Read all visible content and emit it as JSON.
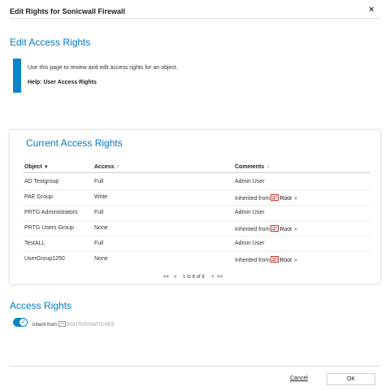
{
  "window": {
    "title": "Edit Rights for Sonicwall Firewall",
    "close_symbol": "×"
  },
  "intro": {
    "heading": "Edit Access Rights",
    "description": "Use this page to review and edit access rights for an object.",
    "help_link": "Help: User Access Rights"
  },
  "table": {
    "title": "Current Access Rights",
    "columns": [
      "Object",
      "Access",
      "Comments"
    ],
    "rows": [
      {
        "object": "AD Testgroup",
        "access": "Full",
        "comment": "Admin User",
        "inherit_target": ""
      },
      {
        "object": "PAE Group",
        "access": "Write",
        "comment": "Inherited from",
        "inherit_target": "Root"
      },
      {
        "object": "PRTG Administrators",
        "access": "Full",
        "comment": "Admin User",
        "inherit_target": ""
      },
      {
        "object": "PRTG Users Group",
        "access": "None",
        "comment": "Inherited from",
        "inherit_target": "Root"
      },
      {
        "object": "TestALL",
        "access": "Full",
        "comment": "Admin User",
        "inherit_target": ""
      },
      {
        "object": "UserGroup1250",
        "access": "None",
        "comment": "Inherited from",
        "inherit_target": "Root"
      }
    ],
    "pagination": {
      "first": "<<",
      "prev": "<",
      "summary": "1 to 6 of 6",
      "next": ">",
      "last": ">>"
    }
  },
  "access_rights": {
    "heading": "Access Rights",
    "toggle_on": true,
    "inherit_label": "inherit from",
    "inherit_group": "ROUTER/SWITCHES"
  },
  "footer": {
    "cancel_label": "Cancel",
    "ok_label": "OK"
  },
  "colors": {
    "accent": "#0078c8",
    "info_bar": "#0b84c8"
  }
}
